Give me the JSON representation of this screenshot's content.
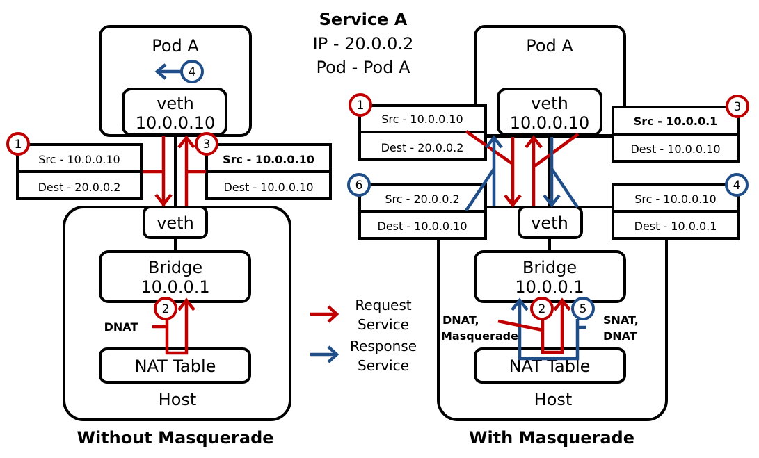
{
  "service": {
    "title": "Service A",
    "ip_line": "IP - 20.0.0.2",
    "pod_line": "Pod - Pod A"
  },
  "colors": {
    "request": "#c00000",
    "response": "#1f4e89"
  },
  "legend": {
    "request": [
      "Request",
      "Service"
    ],
    "response": [
      "Response",
      "Service"
    ]
  },
  "left": {
    "caption": "Without Masquerade",
    "pod_label": "Pod A",
    "pod_veth": [
      "veth",
      "10.0.0.10"
    ],
    "host_veth": "veth",
    "bridge": [
      "Bridge",
      "10.0.0.1"
    ],
    "nat_table": "NAT Table",
    "host_label": "Host",
    "nat_label": "DNAT",
    "steps": [
      {
        "n": "1",
        "color": "request",
        "src": "Src - 10.0.0.10",
        "dest": "Dest - 20.0.0.2",
        "src_bold": false
      },
      {
        "n": "2",
        "color": "request"
      },
      {
        "n": "3",
        "color": "request",
        "src": "Src - 10.0.0.10",
        "dest": "Dest - 10.0.0.10",
        "src_bold": true
      },
      {
        "n": "4",
        "color": "response"
      }
    ]
  },
  "right": {
    "caption": "With Masquerade",
    "pod_label": "Pod A",
    "pod_veth": [
      "veth",
      "10.0.0.10"
    ],
    "host_veth": "veth",
    "bridge": [
      "Bridge",
      "10.0.0.1"
    ],
    "nat_table": "NAT Table",
    "host_label": "Host",
    "nat_label_request": [
      "DNAT,",
      "Masquerade"
    ],
    "nat_label_response": [
      "SNAT,",
      "DNAT"
    ],
    "steps": [
      {
        "n": "1",
        "color": "request",
        "src": "Src - 10.0.0.10",
        "dest": "Dest - 20.0.0.2",
        "src_bold": false
      },
      {
        "n": "2",
        "color": "request"
      },
      {
        "n": "3",
        "color": "request",
        "src": "Src - 10.0.0.1",
        "dest": "Dest - 10.0.0.10",
        "src_bold": true
      },
      {
        "n": "4",
        "color": "response",
        "src": "Src - 10.0.0.10",
        "dest": "Dest - 10.0.0.1",
        "src_bold": false
      },
      {
        "n": "5",
        "color": "response"
      },
      {
        "n": "6",
        "color": "response",
        "src": "Src - 20.0.0.2",
        "dest": "Dest - 10.0.0.10",
        "src_bold": false
      }
    ]
  }
}
